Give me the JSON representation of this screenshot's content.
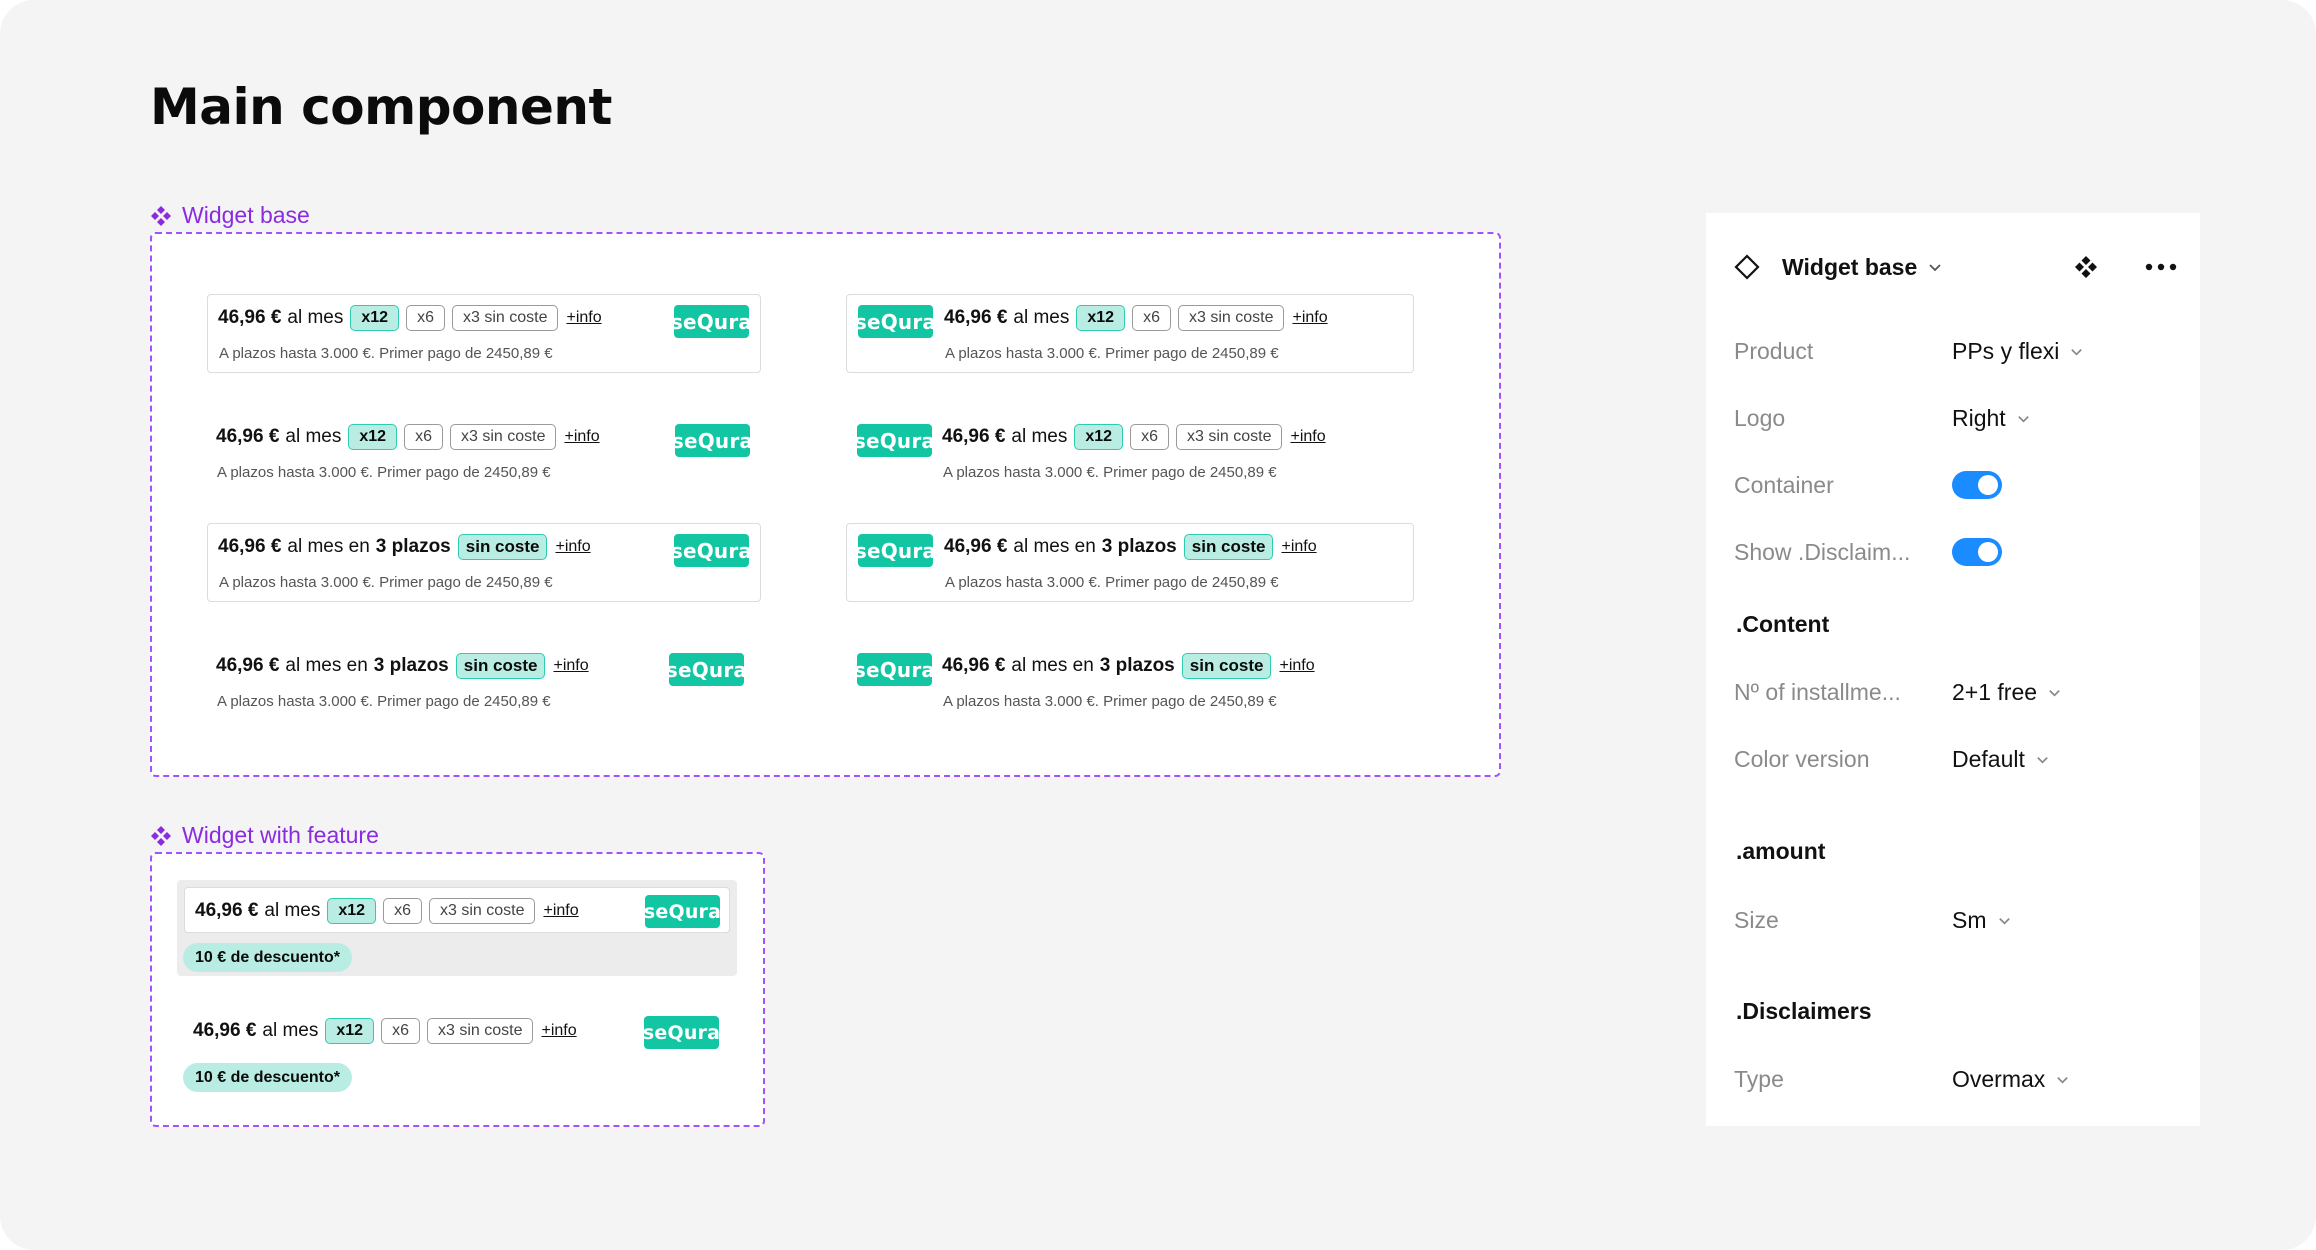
{
  "page": {
    "title": "Main component"
  },
  "frames": {
    "base_label": "Widget base",
    "feature_label": "Widget with feature"
  },
  "widget_text": {
    "amount": "46,96 €",
    "per_month": "al mes",
    "per_month_in": "al mes en",
    "plazos": "3 plazos",
    "chip_x12": "x12",
    "chip_x6": "x6",
    "chip_x3": "x3 sin coste",
    "chip_sin_coste": "sin coste",
    "info": "+info",
    "disclaimer": "A plazos hasta 3.000 €. Primer pago de 2450,89 €",
    "logo": "seQura",
    "discount": "10 € de descuento*"
  },
  "colors": {
    "accent_purple": "#a352ff",
    "sequra_green": "#12c6a4",
    "chip_selected_bg": "#b9ede3",
    "toggle_blue": "#1a8cff"
  },
  "panel": {
    "title": "Widget base",
    "props": [
      {
        "label": "Product",
        "value": "PPs y flexi"
      },
      {
        "label": "Logo",
        "value": "Right"
      },
      {
        "label": "Container",
        "toggle": true
      },
      {
        "label": "Show .Disclaim...",
        "toggle": true
      }
    ],
    "content_title": ".Content",
    "content_props": [
      {
        "label": "Nº of installme...",
        "value": "2+1 free"
      },
      {
        "label": "Color version",
        "value": "Default"
      }
    ],
    "amount_title": ".amount",
    "amount_props": [
      {
        "label": "Size",
        "value": "Sm"
      }
    ],
    "disclaimers_title": ".Disclaimers",
    "disclaimers_props": [
      {
        "label": "Type",
        "value": "Overmax"
      }
    ]
  }
}
